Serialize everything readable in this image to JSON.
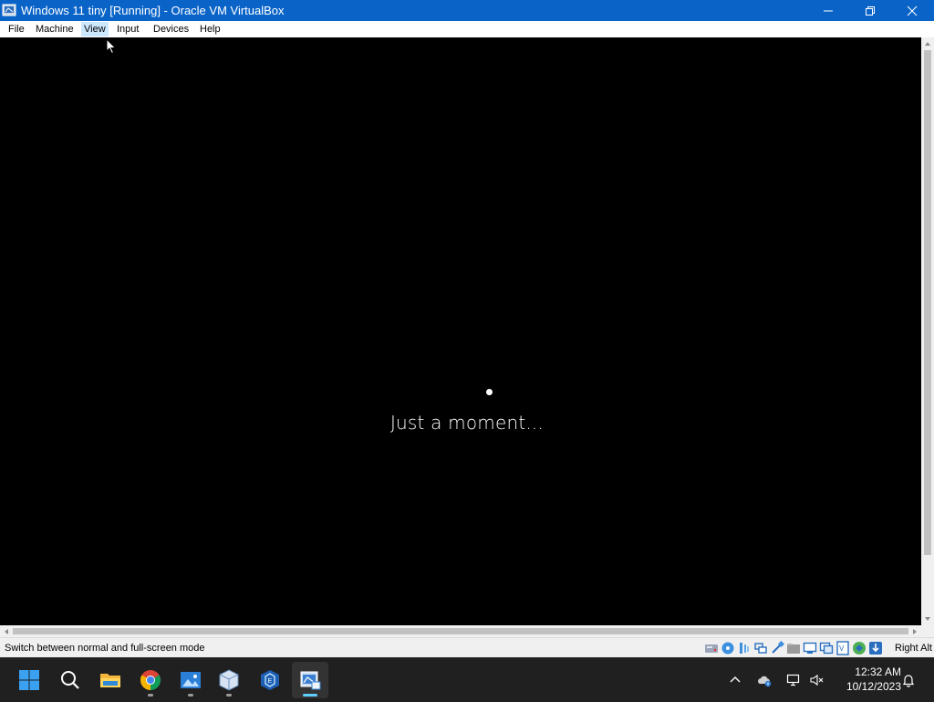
{
  "window": {
    "title": "Windows 11 tiny [Running] - Oracle VM VirtualBox"
  },
  "menu": {
    "items": [
      {
        "label": "File"
      },
      {
        "label": "Machine"
      },
      {
        "label": "View"
      },
      {
        "label": "Input"
      },
      {
        "label": "Devices"
      },
      {
        "label": "Help"
      }
    ],
    "hovered": "View"
  },
  "vm": {
    "message": "Just a moment..."
  },
  "statusbar": {
    "tip": "Switch between normal and full-screen mode",
    "host_key": "Right Alt",
    "icons": [
      "hard-disk-icon",
      "optical-drive-icon",
      "audio-icon",
      "network-icon",
      "usb-icon",
      "shared-folders-icon",
      "display-icon",
      "video-capture-icon",
      "virtualization-icon",
      "mouse-integration-icon",
      "keyboard-capture-icon"
    ]
  },
  "taskbar": {
    "apps": [
      "start-icon",
      "search-icon",
      "file-explorer-icon",
      "chrome-icon",
      "photos-app-icon",
      "virtualbox-icon",
      "virtualbox-manager-icon",
      "virtualbox-vm-icon"
    ],
    "active_app": "virtualbox-vm-icon",
    "tray_icons": [
      "chevron-up-icon",
      "onedrive-icon",
      "network-icon",
      "volume-muted-icon"
    ],
    "time": "12:32 AM",
    "date": "10/12/2023"
  },
  "colors": {
    "titlebar": "#0a64c8",
    "taskbar": "#202020",
    "active_indicator": "#60cdff"
  }
}
